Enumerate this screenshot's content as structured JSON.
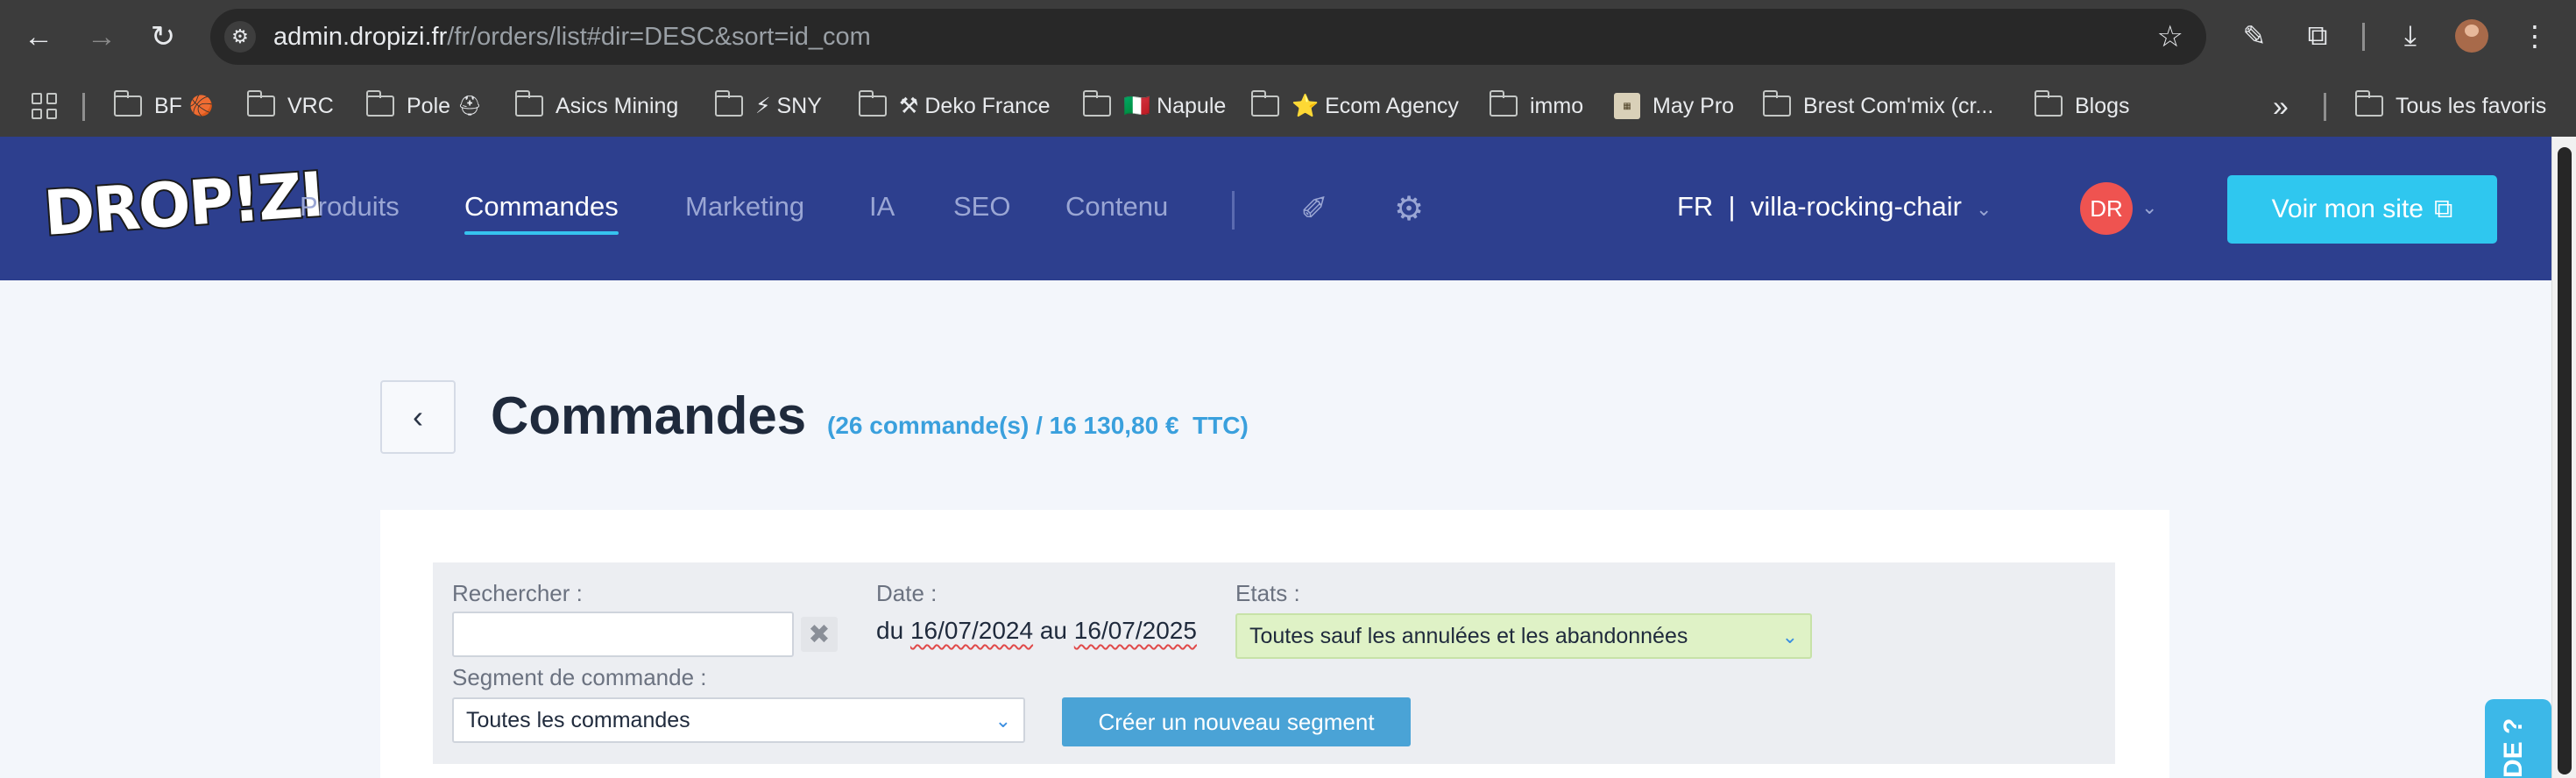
{
  "browser": {
    "url_host": "admin.dropizi.fr",
    "url_path": "/fr/orders/list#dir=DESC&sort=id_com",
    "bookmarks": [
      {
        "label": "BF",
        "emoji": "🏀"
      },
      {
        "label": "VRC",
        "emoji": ""
      },
      {
        "label": "Pole",
        "emoji": "⛑"
      },
      {
        "label": "Asics Mining",
        "emoji": ""
      },
      {
        "label": "⚡ SNY",
        "emoji": ""
      },
      {
        "label": "⚒ Deko France",
        "emoji": ""
      },
      {
        "label": "🇮🇹 Napule",
        "emoji": ""
      },
      {
        "label": "⭐ Ecom Agency",
        "emoji": ""
      },
      {
        "label": "immo",
        "emoji": ""
      },
      {
        "label": "May Pro",
        "emoji": ""
      },
      {
        "label": "Brest Com'mix (cr...",
        "emoji": ""
      },
      {
        "label": "Blogs",
        "emoji": ""
      }
    ],
    "overflow_label": "»",
    "all_bookmarks_label": "Tous les favoris"
  },
  "header": {
    "logo": "DROP!ZI",
    "menu": [
      "Produits",
      "Commandes",
      "Marketing",
      "IA",
      "SEO",
      "Contenu"
    ],
    "active_menu": "Commandes",
    "store_label": "FR  |  villa-rocking-chair",
    "user_initials": "DR",
    "view_site_label": "Voir mon site"
  },
  "page": {
    "title": "Commandes",
    "summary": "(26 commande(s) / 16 130,80 €  TTC)",
    "back_icon": "chevron-left-icon"
  },
  "filters": {
    "search_label": "Rechercher :",
    "search_value": "",
    "clear_icon": "✖",
    "date_label": "Date :",
    "date_prefix": "du",
    "date_from": "16/07/2024",
    "date_mid": "au",
    "date_to": "16/07/2025",
    "states_label": "Etats :",
    "states_value": "Toutes sauf les annulées et les abandonnées",
    "segment_label": "Segment de commande :",
    "segment_value": "Toutes les commandes",
    "new_segment_label": "Créer un nouveau segment"
  },
  "help_tab": "DE ?",
  "colors": {
    "header_bg": "#2d3f8e",
    "accent": "#2fc7ef",
    "summary": "#3aa0dd",
    "states_bg": "#dff2c6",
    "avatar": "#ef5350"
  }
}
